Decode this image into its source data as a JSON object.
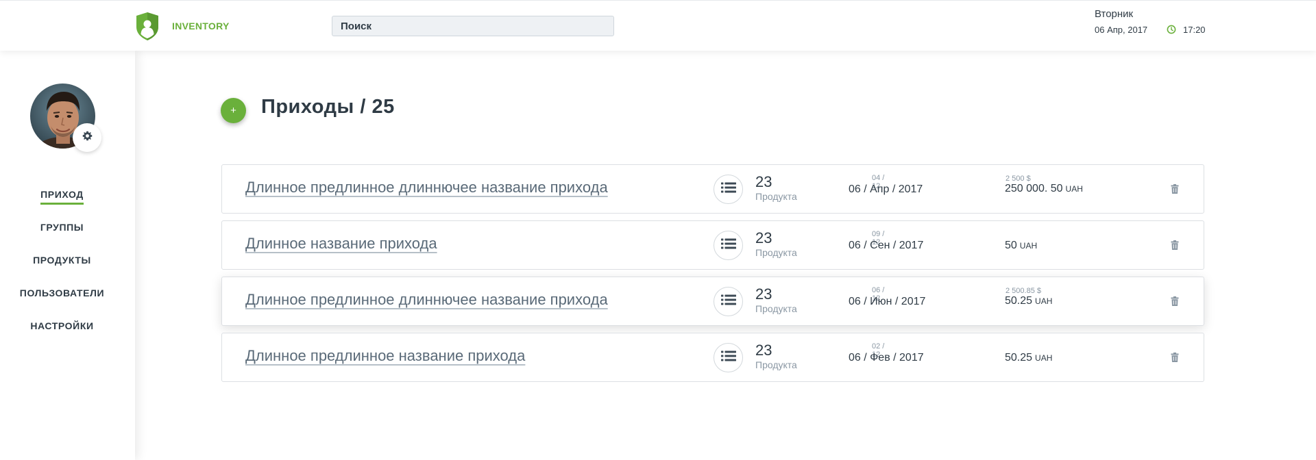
{
  "header": {
    "logo_text": "INVENTORY",
    "search_placeholder": "Поиск",
    "day_name": "Вторник",
    "date": "06 Апр, 2017",
    "time": "17:20"
  },
  "sidebar": {
    "nav": [
      {
        "label": "ПРИХОД",
        "active": true
      },
      {
        "label": "ГРУППЫ",
        "active": false
      },
      {
        "label": "ПРОДУКТЫ",
        "active": false
      },
      {
        "label": "ПОЛЬЗОВАТЕЛИ",
        "active": false
      },
      {
        "label": "НАСТРОЙКИ",
        "active": false
      }
    ]
  },
  "main": {
    "add_button": "+",
    "title": "Приходы / 25",
    "rows": [
      {
        "name": "Длинное предлинное  длиннючее название прихода",
        "count": "23",
        "count_label": "Продукта",
        "small_date": "04 / 12",
        "date": "06 / Апр / 2017",
        "price_usd": "2 500 $",
        "price": "250 000. 50",
        "currency": "UAH"
      },
      {
        "name": "Длинное название прихода",
        "count": "23",
        "count_label": "Продукта",
        "small_date": "09 / 12",
        "date": "06 / Сен / 2017",
        "price_usd": "",
        "price": "50",
        "currency": "UAH"
      },
      {
        "name": "Длинное предлинное  длиннючее название прихода",
        "count": "23",
        "count_label": "Продукта",
        "small_date": "06 / 12",
        "date": "06 / Июн / 2017",
        "price_usd": "2 500.85 $",
        "price": "50.25",
        "currency": "UAH"
      },
      {
        "name": "Длинное предлинное  название прихода",
        "count": "23",
        "count_label": "Продукта",
        "small_date": "02 / 12",
        "date": "06 / Фев / 2017",
        "price_usd": "",
        "price": "50.25",
        "currency": "UAH"
      }
    ]
  },
  "colors": {
    "accent": "#6ab03b",
    "text": "#2f3b45",
    "muted": "#8a97a3",
    "link": "#5a6a78"
  },
  "icons": [
    "shield-user-icon",
    "clock-icon",
    "gear-icon",
    "list-icon",
    "trash-icon",
    "plus-icon"
  ]
}
